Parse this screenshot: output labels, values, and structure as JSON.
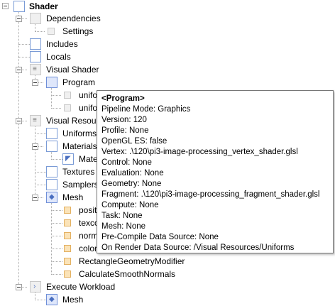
{
  "tree": {
    "shader": "Shader",
    "dependencies": "Dependencies",
    "settings": "Settings",
    "includes": "Includes",
    "locals": "Locals",
    "visual_shader": "Visual Shader",
    "program": "Program",
    "program_child_1": "unifo",
    "program_child_2": "unifo",
    "visual_resources": "Visual Resour",
    "uniforms": "Uniforms",
    "materials": "Materials",
    "material_child": "Mate",
    "textures": "Textures",
    "samplers": "Samplers",
    "mesh": "Mesh",
    "mesh_child_1": "posit",
    "mesh_child_2": "texco",
    "mesh_child_3": "norm",
    "mesh_child_4": "color",
    "mesh_child_5": "RectangleGeometryModifier",
    "mesh_child_6": "CalculateSmoothNormals",
    "execute_workload": "Execute Workload",
    "execute_mesh": "Mesh"
  },
  "tooltip": {
    "title": "<Program>",
    "lines": [
      "Pipeline Mode: Graphics",
      "Version: 120",
      "Profile: None",
      "OpenGL ES: false",
      "Vertex: .\\120\\pi3-image-processing_vertex_shader.glsl",
      "Control: None",
      "Evaluation: None",
      "Geometry: None",
      "Fragment: .\\120\\pi3-image-processing_fragment_shader.glsl",
      "Compute: None",
      "Task: None",
      "Mesh: None",
      "Pre-Compile Data Source: None",
      "On Render Data Source: /Visual Resources/Uniforms"
    ]
  },
  "icons": {
    "folder": "folder-icon",
    "settings": "settings-icon",
    "list": "list-icon",
    "program": "program-icon",
    "mesh": "mesh-icon",
    "attribute": "attribute-icon",
    "execute": "execute-icon"
  },
  "colors": {
    "icon_border_blue": "#7a9bd6",
    "icon_orange": "#e3b061",
    "tooltip_border": "#767676"
  }
}
